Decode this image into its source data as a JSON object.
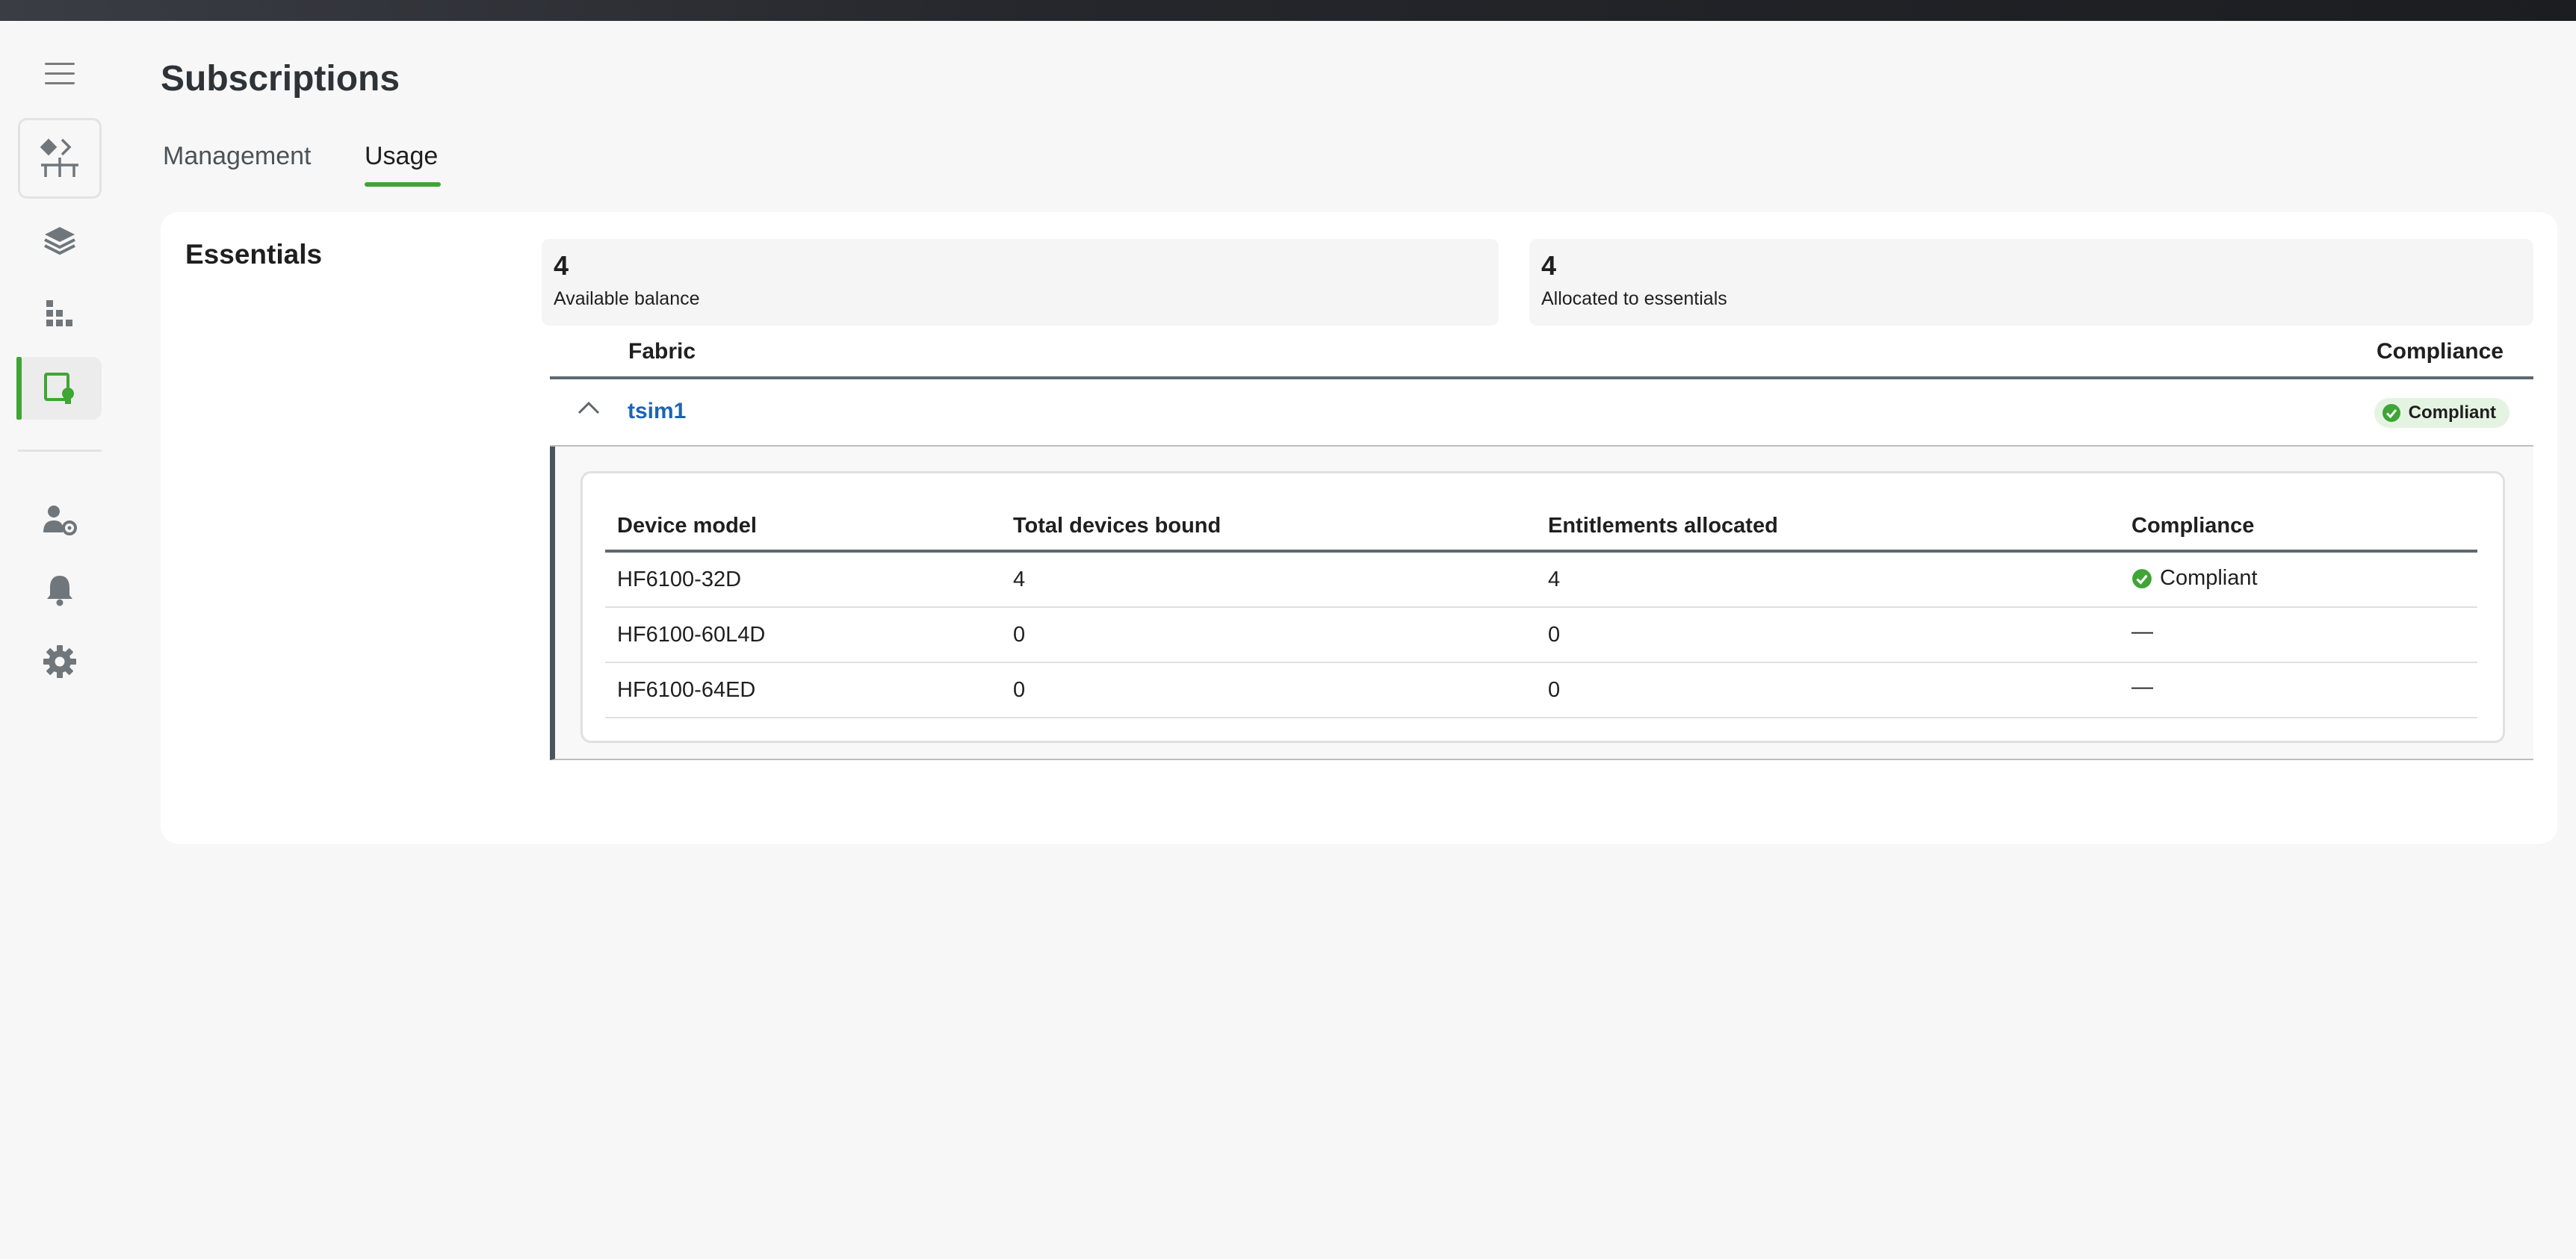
{
  "page": {
    "title": "Subscriptions"
  },
  "sidebar": {
    "items": [
      {
        "icon": "hamburger-menu-icon"
      },
      {
        "icon": "fabric-topology-icon"
      },
      {
        "icon": "layers-icon"
      },
      {
        "icon": "grid-blocks-icon"
      },
      {
        "icon": "subscription-certificate-icon",
        "active": true
      },
      {
        "icon": "user-settings-icon"
      },
      {
        "icon": "bell-icon"
      },
      {
        "icon": "gear-icon"
      }
    ],
    "accent_color": "#3fa535"
  },
  "tabs": [
    {
      "label": "Management",
      "selected": false
    },
    {
      "label": "Usage",
      "selected": true
    }
  ],
  "essentials": {
    "title": "Essentials",
    "available": {
      "value": "4",
      "label": "Available balance"
    },
    "allocated": {
      "value": "4",
      "label": "Allocated to essentials"
    },
    "fabric_table": {
      "headers": {
        "fabric": "Fabric",
        "compliance": "Compliance"
      },
      "rows": [
        {
          "name": "tsim1",
          "compliance": "Compliant",
          "expanded": true,
          "devices": {
            "headers": [
              "Device model",
              "Total devices bound",
              "Entitlements allocated",
              "Compliance"
            ],
            "rows": [
              {
                "model": "HF6100-32D",
                "bound": "4",
                "allocated": "4",
                "compliance": "Compliant"
              },
              {
                "model": "HF6100-60L4D",
                "bound": "0",
                "allocated": "0",
                "compliance": "—"
              },
              {
                "model": "HF6100-64ED",
                "bound": "0",
                "allocated": "0",
                "compliance": "—"
              }
            ]
          }
        }
      ]
    }
  },
  "colors": {
    "link": "#1c64b4",
    "compliant_green": "#3fa535",
    "compliant_badge_bg": "#e5f4e2"
  }
}
